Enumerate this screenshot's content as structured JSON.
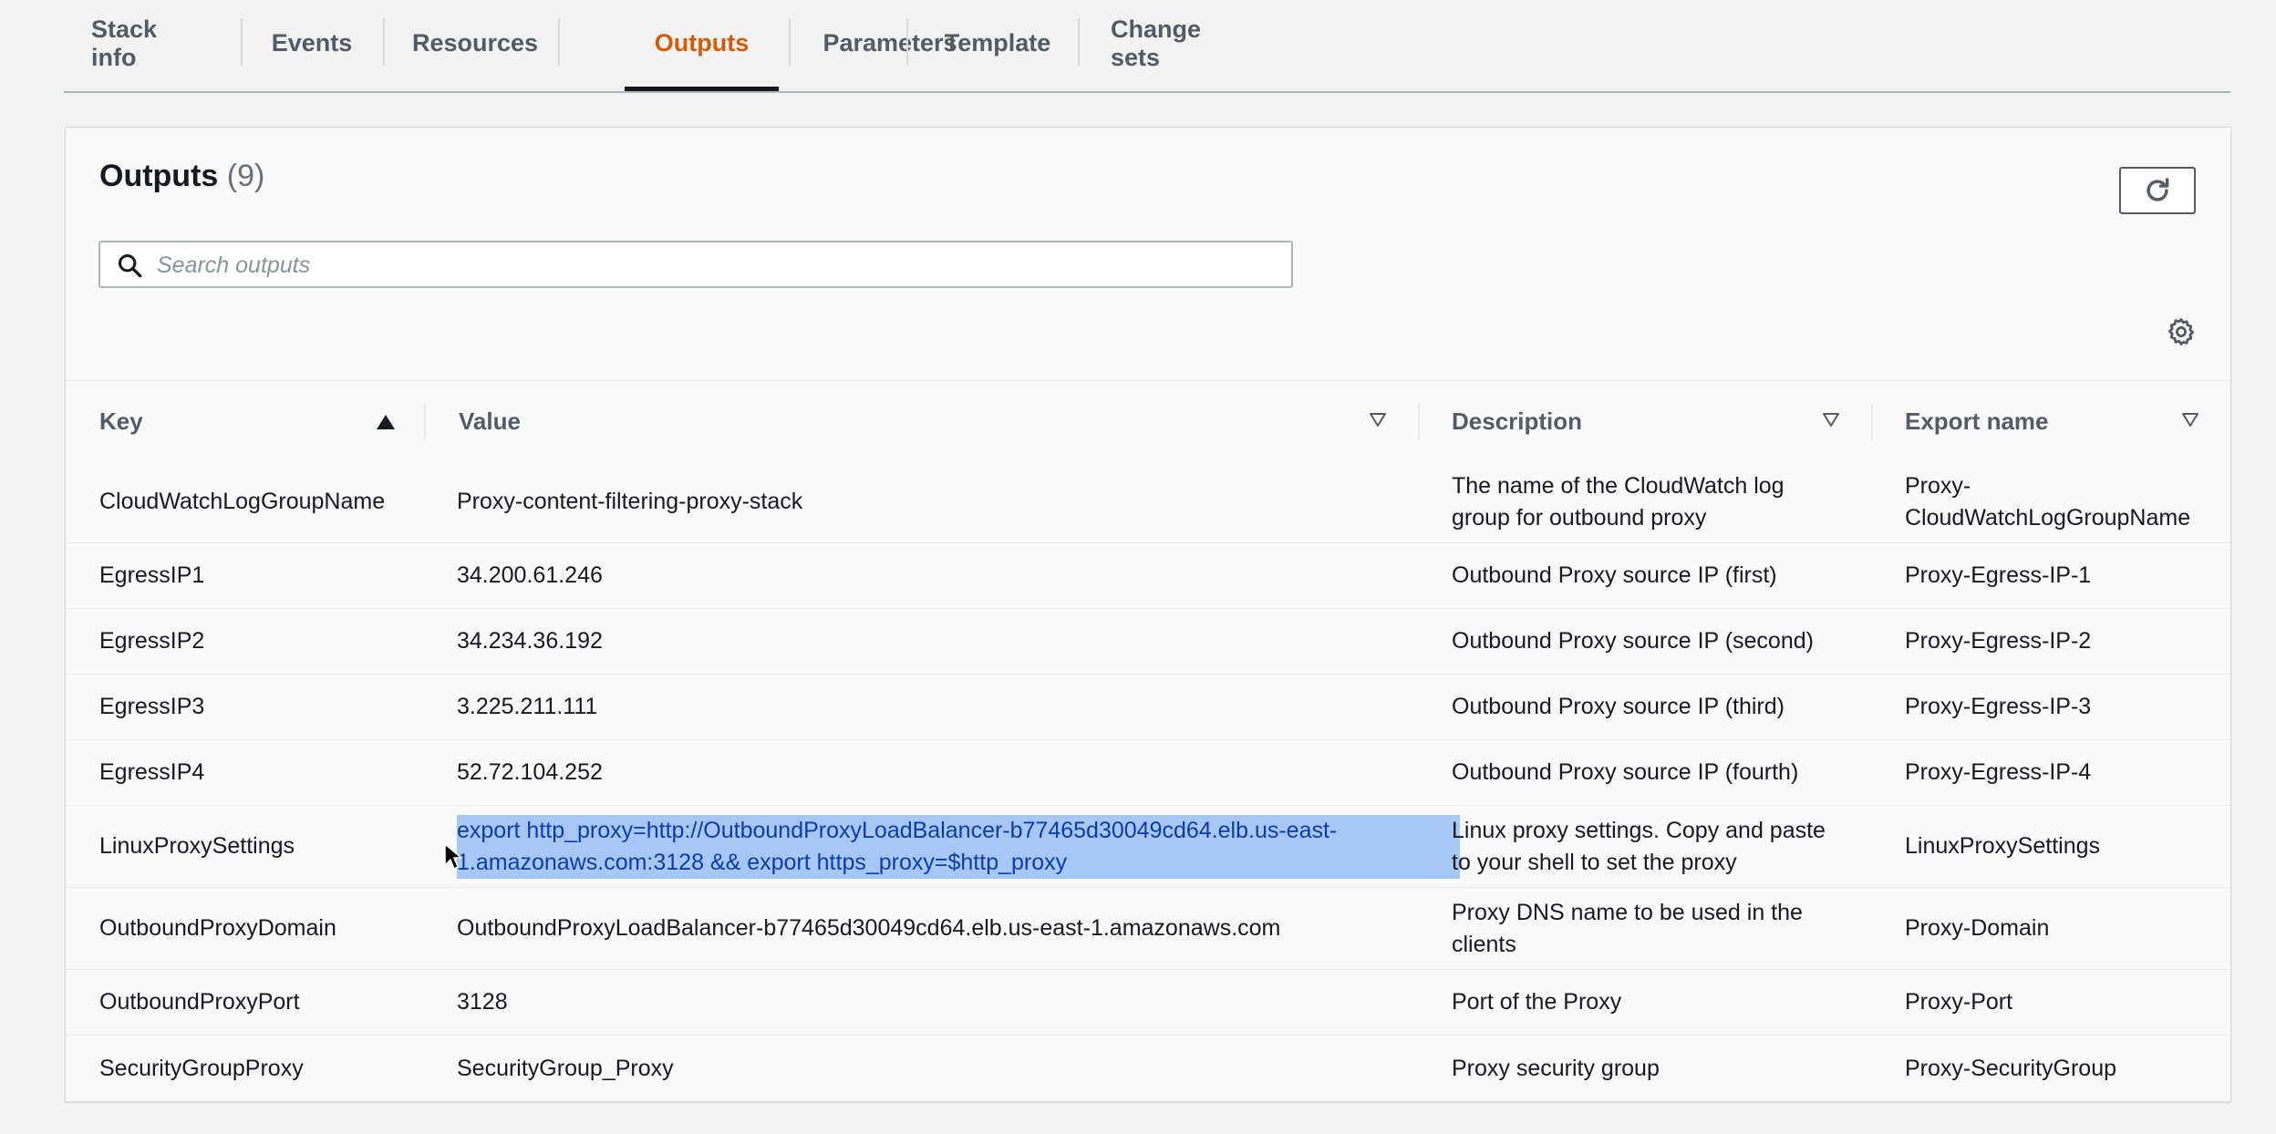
{
  "tabs": [
    {
      "label": "Stack info",
      "active": false
    },
    {
      "label": "Events",
      "active": false
    },
    {
      "label": "Resources",
      "active": false
    },
    {
      "label": "Outputs",
      "active": true
    },
    {
      "label": "Parameters",
      "active": false
    },
    {
      "label": "Template",
      "active": false
    },
    {
      "label": "Change sets",
      "active": false
    }
  ],
  "panel": {
    "title": "Outputs",
    "count": "(9)",
    "search_placeholder": "Search outputs"
  },
  "table": {
    "columns": [
      {
        "label": "Key",
        "sort": "ascending"
      },
      {
        "label": "Value",
        "sort": "none"
      },
      {
        "label": "Description",
        "sort": "none"
      },
      {
        "label": "Export name",
        "sort": "none"
      }
    ],
    "rows": [
      {
        "key": "CloudWatchLogGroupName",
        "value": "Proxy-content-filtering-proxy-stack",
        "description": "The name of the CloudWatch log group for outbound proxy",
        "export": "Proxy-CloudWatchLogGroupName"
      },
      {
        "key": "EgressIP1",
        "value": "34.200.61.246",
        "description": "Outbound Proxy source IP (first)",
        "export": "Proxy-Egress-IP-1"
      },
      {
        "key": "EgressIP2",
        "value": "34.234.36.192",
        "description": "Outbound Proxy source IP (second)",
        "export": "Proxy-Egress-IP-2"
      },
      {
        "key": "EgressIP3",
        "value": "3.225.211.111",
        "description": "Outbound Proxy source IP (third)",
        "export": "Proxy-Egress-IP-3"
      },
      {
        "key": "EgressIP4",
        "value": "52.72.104.252",
        "description": "Outbound Proxy source IP (fourth)",
        "export": "Proxy-Egress-IP-4"
      },
      {
        "key": "LinuxProxySettings",
        "value": "export http_proxy=http://OutboundProxyLoadBalancer-b77465d30049cd64.elb.us-east-1.amazonaws.com:3128 && export https_proxy=$http_proxy",
        "description": "Linux proxy settings. Copy and paste to your shell to set the proxy",
        "export": "LinuxProxySettings",
        "selected": true
      },
      {
        "key": "OutboundProxyDomain",
        "value": "OutboundProxyLoadBalancer-b77465d30049cd64.elb.us-east-1.amazonaws.com",
        "description": "Proxy DNS name to be used in the clients",
        "export": "Proxy-Domain"
      },
      {
        "key": "OutboundProxyPort",
        "value": "3128",
        "description": "Port of the Proxy",
        "export": "Proxy-Port"
      },
      {
        "key": "SecurityGroupProxy",
        "value": "SecurityGroup_Proxy",
        "description": "Proxy security group",
        "export": "Proxy-SecurityGroup"
      }
    ]
  },
  "colors": {
    "active_tab": "#d45b07",
    "selection": "#a6c8f7",
    "selection_text": "#0e3cb0"
  },
  "icons": [
    "search-icon",
    "refresh-icon",
    "gear-icon",
    "sort-ascending-icon",
    "sort-descending-icon",
    "mouse-cursor-icon"
  ]
}
